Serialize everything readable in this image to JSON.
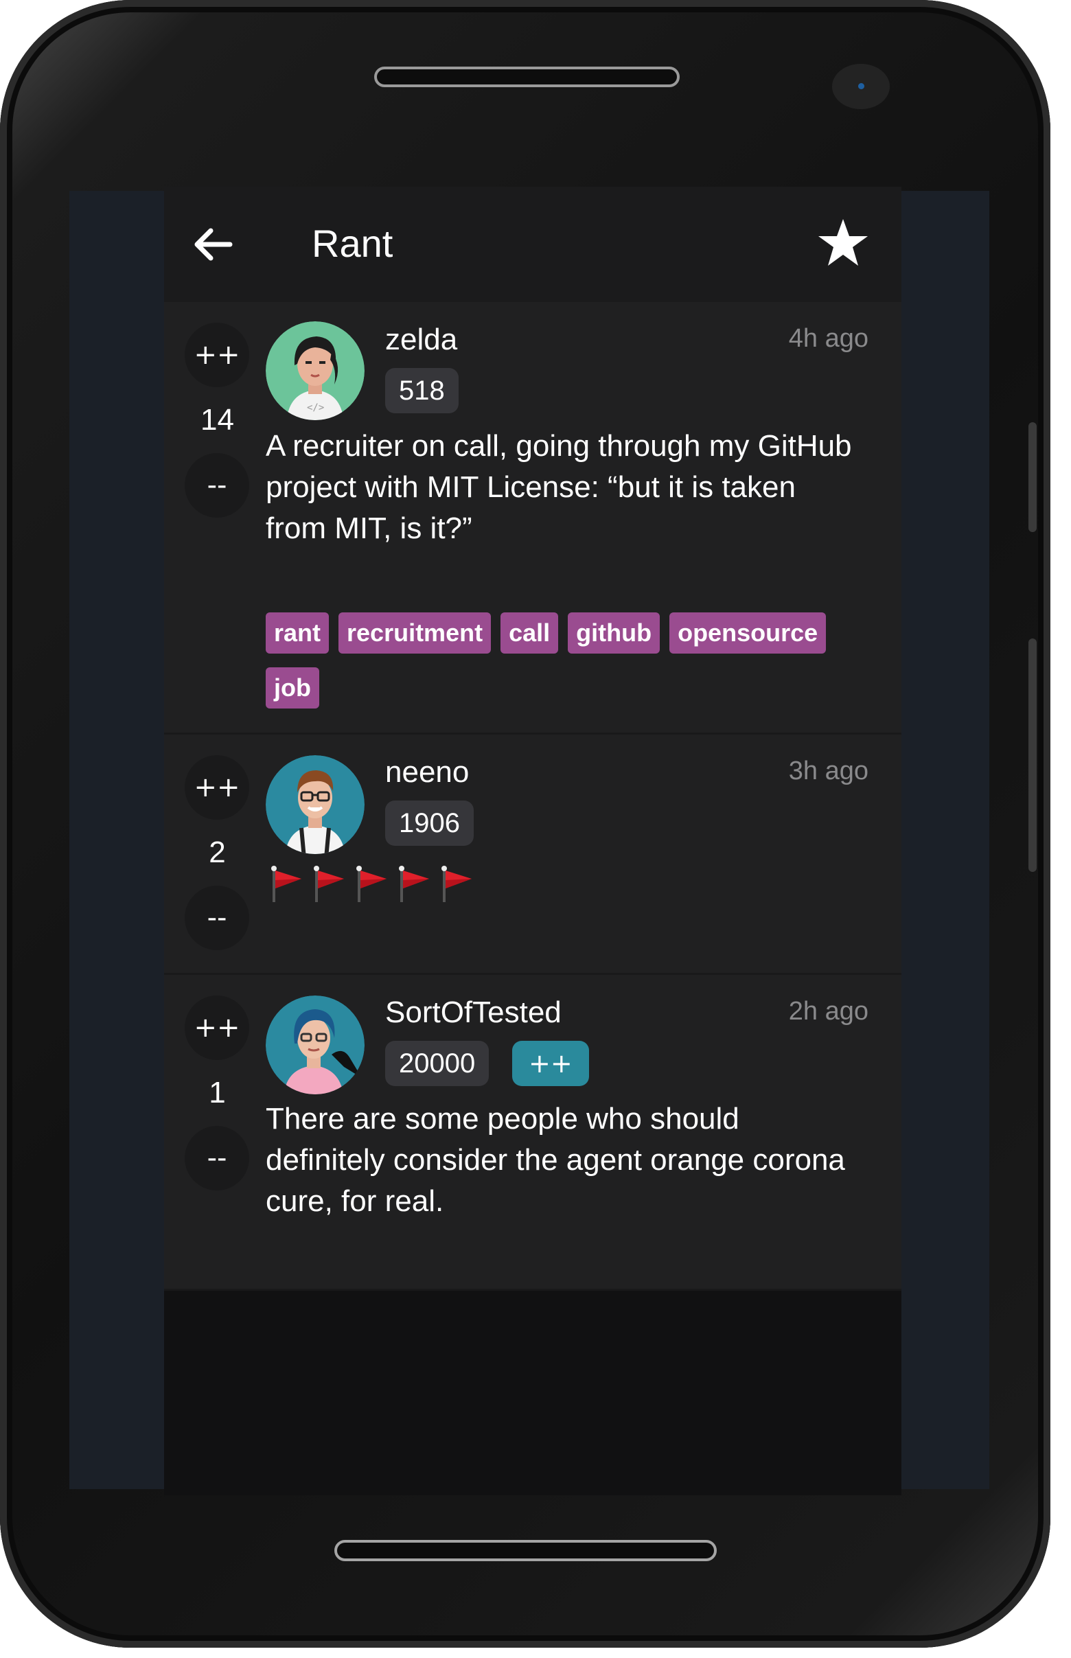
{
  "appbar": {
    "title": "Rant",
    "back_icon": "arrow-left-icon",
    "favorite_icon": "star-icon"
  },
  "vote": {
    "up_label": "++",
    "down_label": "--"
  },
  "rant": {
    "username": "zelda",
    "score": "518",
    "time": "4h ago",
    "votes": "14",
    "text": "A recruiter on call, going through my GitHub project with MIT License: “but it is taken from MIT, is it?”",
    "tags": [
      "rant",
      "recruitment",
      "call",
      "github",
      "opensource",
      "job"
    ]
  },
  "comments": [
    {
      "username": "neeno",
      "score": "1906",
      "time": "3h ago",
      "votes": "2",
      "flags": 5,
      "flag_icon": "red-flag-icon"
    },
    {
      "username": "SortOfTested",
      "score": "20000",
      "supporter_badge": "++",
      "time": "2h ago",
      "votes": "1",
      "text": "There are some people who should definitely consider the agent orange corona cure, for real."
    }
  ],
  "colors": {
    "background": "#111112",
    "card": "#202021",
    "appbar": "#1b1b1c",
    "tag": "#9a4c90",
    "supporter": "#2a8a9c",
    "score_pill": "#36363a"
  }
}
